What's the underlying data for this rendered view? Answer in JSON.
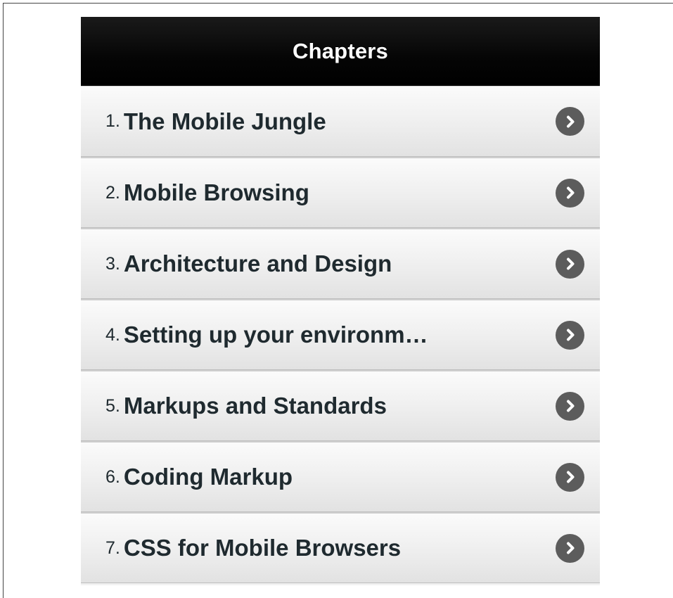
{
  "header": {
    "title": "Chapters"
  },
  "chapters": [
    {
      "number": "1.",
      "title": "The Mobile Jungle"
    },
    {
      "number": "2.",
      "title": "Mobile Browsing"
    },
    {
      "number": "3.",
      "title": "Architecture and Design"
    },
    {
      "number": "4.",
      "title": "Setting up your environm…"
    },
    {
      "number": "5.",
      "title": "Markups and Standards"
    },
    {
      "number": "6.",
      "title": "Coding Markup"
    },
    {
      "number": "7.",
      "title": "CSS for Mobile Browsers"
    }
  ],
  "icons": {
    "item_arrow": "chevron-right-circle-icon"
  },
  "colors": {
    "header_bg": "#000000",
    "header_text": "#ffffff",
    "item_text": "#1f2a2f",
    "chevron_bg": "#5c5c5c"
  }
}
